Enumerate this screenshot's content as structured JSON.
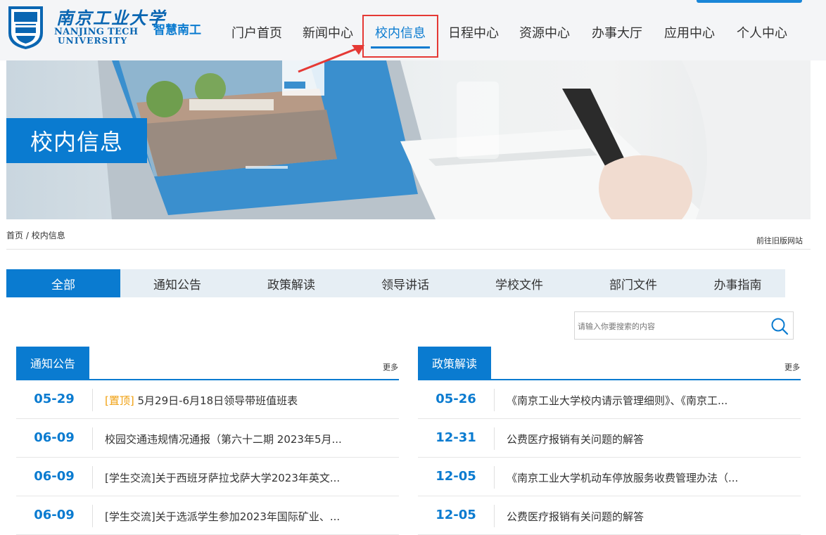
{
  "brand": {
    "cn_name": "南京工业大学",
    "en_line1": "NANJING TECH",
    "en_line2": "UNIVERSITY",
    "site_name": "智慧南工",
    "accent": "#0a7bd0"
  },
  "nav": {
    "items": [
      "门户首页",
      "新闻中心",
      "校内信息",
      "日程中心",
      "资源中心",
      "办事大厅",
      "应用中心",
      "个人中心"
    ],
    "active": "校内信息"
  },
  "banner": {
    "title": "校内信息"
  },
  "breadcrumb": {
    "home": "首页",
    "separator": " / ",
    "current": "校内信息",
    "old_site": "前往旧版网站"
  },
  "tabs": [
    "全部",
    "通知公告",
    "政策解读",
    "领导讲话",
    "学校文件",
    "部门文件",
    "办事指南"
  ],
  "search": {
    "placeholder": "请输入你要搜索的内容",
    "icon": "search-icon"
  },
  "panels": {
    "left": {
      "title": "通知公告",
      "more": "更多",
      "rows": [
        {
          "date": "05-29",
          "tag": "[置顶]",
          "title": " 5月29日-6月18日领导带班值班表"
        },
        {
          "date": "06-09",
          "tag": "",
          "title": "校园交通违规情况通报（第六十二期 2023年5月..."
        },
        {
          "date": "06-09",
          "tag": "",
          "title": "[学生交流]关于西班牙萨拉戈萨大学2023年英文..."
        },
        {
          "date": "06-09",
          "tag": "",
          "title": "[学生交流]关于选派学生参加2023年国际矿业、..."
        }
      ]
    },
    "right": {
      "title": "政策解读",
      "more": "更多",
      "rows": [
        {
          "date": "05-26",
          "title": "《南京工业大学校内请示管理细则》、《南京工..."
        },
        {
          "date": "12-31",
          "title": "公费医疗报销有关问题的解答"
        },
        {
          "date": "12-05",
          "title": "《南京工业大学机动车停放服务收费管理办法（..."
        },
        {
          "date": "12-05",
          "title": "公费医疗报销有关问题的解答"
        }
      ]
    }
  }
}
